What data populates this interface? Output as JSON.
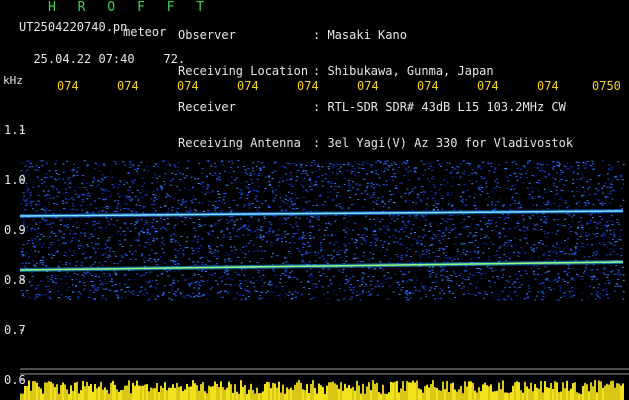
{
  "header": {
    "title": "H R O F F T",
    "filename": "UT2504220740.pn",
    "tag": "meteor",
    "date_time": "25.04.22 07:40",
    "count": "72."
  },
  "meta": [
    {
      "label": "Observer",
      "value": ": Masaki Kano"
    },
    {
      "label": "Receiving Location",
      "value": ": Shibukawa, Gunma, Japan"
    },
    {
      "label": "Receiver",
      "value": ": RTL-SDR SDR# 43dB L15 103.2MHz CW"
    },
    {
      "label": "Receiving Antenna",
      "value": ": 3el Yagi(V) Az 330 for Vladivostok"
    }
  ],
  "axis": {
    "unit": "kHz",
    "y_ticks": [
      "1.1",
      "1.0",
      "0.9",
      "0.8",
      "0.7",
      "0.6"
    ],
    "x_ticks": [
      "074",
      "074",
      "074",
      "074",
      "074",
      "074",
      "074",
      "074",
      "074",
      "0750"
    ]
  },
  "colors": {
    "background": "#000000",
    "header": "#39d353",
    "text": "#e6e6e6",
    "time": "#f2d21b"
  }
}
